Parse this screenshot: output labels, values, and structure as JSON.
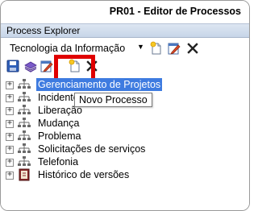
{
  "window": {
    "title": "PR01 - Editor de Processos"
  },
  "panel": {
    "title": "Process Explorer"
  },
  "category_select": {
    "selected": "Tecnologia da Informação"
  },
  "toolbar": {
    "buttons": [
      {
        "icon": "save-icon"
      },
      {
        "icon": "publish-icon"
      },
      {
        "icon": "edit-icon"
      },
      {
        "icon": "new-document-icon",
        "highlighted": true
      },
      {
        "icon": "delete-icon"
      }
    ],
    "tooltip": "Novo Processo"
  },
  "tree": {
    "items": [
      {
        "label": "Gerenciamento de Projetos",
        "selected": true,
        "icon": "process-tree-icon"
      },
      {
        "label": "Incidente",
        "icon": "process-tree-icon"
      },
      {
        "label": "Liberação",
        "icon": "process-tree-icon"
      },
      {
        "label": "Mudança",
        "icon": "process-tree-icon"
      },
      {
        "label": "Problema",
        "icon": "process-tree-icon"
      },
      {
        "label": "Solicitações de serviços",
        "icon": "process-tree-icon"
      },
      {
        "label": "Telefonia",
        "icon": "process-tree-icon"
      },
      {
        "label": "Histórico de versões",
        "icon": "history-book-icon"
      }
    ]
  },
  "colors": {
    "selection": "#3e7be0",
    "highlight_box": "#e00000",
    "panel_header": "#c7d5e8"
  }
}
